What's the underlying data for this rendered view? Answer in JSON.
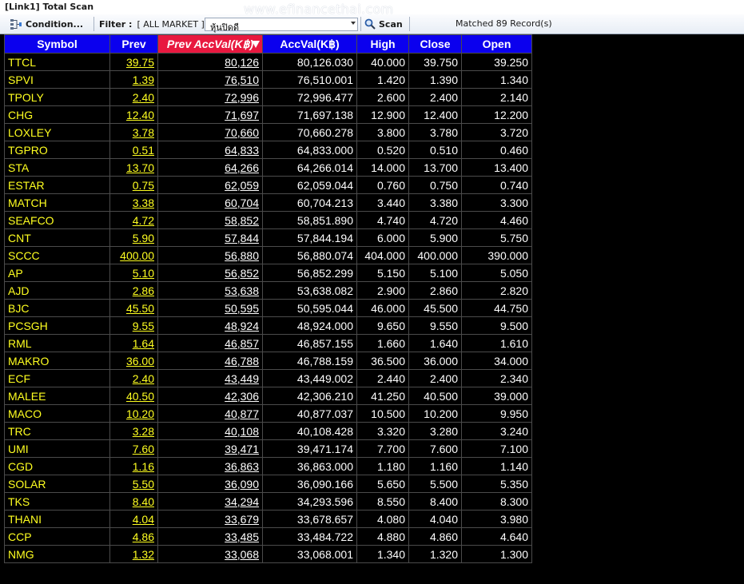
{
  "window": {
    "title": "[Link1] Total Scan"
  },
  "watermark": "www.efinancethai.com",
  "toolbar": {
    "condition_label": "Condition...",
    "filter_label": "Filter :",
    "filter_value": "[ ALL MARKET ]",
    "combo_value": "หุ้นปิดดี",
    "scan_label": "Scan",
    "matched_text": "Matched 89 Record(s)"
  },
  "table": {
    "headers": [
      "Symbol",
      "Prev",
      "Prev AccVal(K฿)",
      "AccVal(K฿)",
      "High",
      "Close",
      "Open"
    ],
    "rows": [
      [
        "TTCL",
        "39.75",
        "80,126",
        "80,126.030",
        "40.000",
        "39.750",
        "39.250"
      ],
      [
        "SPVI",
        "1.39",
        "76,510",
        "76,510.001",
        "1.420",
        "1.390",
        "1.340"
      ],
      [
        "TPOLY",
        "2.40",
        "72,996",
        "72,996.477",
        "2.600",
        "2.400",
        "2.140"
      ],
      [
        "CHG",
        "12.40",
        "71,697",
        "71,697.138",
        "12.900",
        "12.400",
        "12.200"
      ],
      [
        "LOXLEY",
        "3.78",
        "70,660",
        "70,660.278",
        "3.800",
        "3.780",
        "3.720"
      ],
      [
        "TGPRO",
        "0.51",
        "64,833",
        "64,833.000",
        "0.520",
        "0.510",
        "0.460"
      ],
      [
        "STA",
        "13.70",
        "64,266",
        "64,266.014",
        "14.000",
        "13.700",
        "13.400"
      ],
      [
        "ESTAR",
        "0.75",
        "62,059",
        "62,059.044",
        "0.760",
        "0.750",
        "0.740"
      ],
      [
        "MATCH",
        "3.38",
        "60,704",
        "60,704.213",
        "3.440",
        "3.380",
        "3.300"
      ],
      [
        "SEAFCO",
        "4.72",
        "58,852",
        "58,851.890",
        "4.740",
        "4.720",
        "4.460"
      ],
      [
        "CNT",
        "5.90",
        "57,844",
        "57,844.194",
        "6.000",
        "5.900",
        "5.750"
      ],
      [
        "SCCC",
        "400.00",
        "56,880",
        "56,880.074",
        "404.000",
        "400.000",
        "390.000"
      ],
      [
        "AP",
        "5.10",
        "56,852",
        "56,852.299",
        "5.150",
        "5.100",
        "5.050"
      ],
      [
        "AJD",
        "2.86",
        "53,638",
        "53,638.082",
        "2.900",
        "2.860",
        "2.820"
      ],
      [
        "BJC",
        "45.50",
        "50,595",
        "50,595.044",
        "46.000",
        "45.500",
        "44.750"
      ],
      [
        "PCSGH",
        "9.55",
        "48,924",
        "48,924.000",
        "9.650",
        "9.550",
        "9.500"
      ],
      [
        "RML",
        "1.64",
        "46,857",
        "46,857.155",
        "1.660",
        "1.640",
        "1.610"
      ],
      [
        "MAKRO",
        "36.00",
        "46,788",
        "46,788.159",
        "36.500",
        "36.000",
        "34.000"
      ],
      [
        "ECF",
        "2.40",
        "43,449",
        "43,449.002",
        "2.440",
        "2.400",
        "2.340"
      ],
      [
        "MALEE",
        "40.50",
        "42,306",
        "42,306.210",
        "41.250",
        "40.500",
        "39.000"
      ],
      [
        "MACO",
        "10.20",
        "40,877",
        "40,877.037",
        "10.500",
        "10.200",
        "9.950"
      ],
      [
        "TRC",
        "3.28",
        "40,108",
        "40,108.428",
        "3.320",
        "3.280",
        "3.240"
      ],
      [
        "UMI",
        "7.60",
        "39,471",
        "39,471.174",
        "7.700",
        "7.600",
        "7.100"
      ],
      [
        "CGD",
        "1.16",
        "36,863",
        "36,863.000",
        "1.180",
        "1.160",
        "1.140"
      ],
      [
        "SOLAR",
        "5.50",
        "36,090",
        "36,090.166",
        "5.650",
        "5.500",
        "5.350"
      ],
      [
        "TKS",
        "8.40",
        "34,294",
        "34,293.596",
        "8.550",
        "8.400",
        "8.300"
      ],
      [
        "THANI",
        "4.04",
        "33,679",
        "33,678.657",
        "4.080",
        "4.040",
        "3.980"
      ],
      [
        "CCP",
        "4.86",
        "33,485",
        "33,484.722",
        "4.880",
        "4.860",
        "4.640"
      ],
      [
        "NMG",
        "1.32",
        "33,068",
        "33,068.001",
        "1.340",
        "1.320",
        "1.300"
      ]
    ]
  },
  "colors": {
    "header_bg": "#0b00ee",
    "sorted_header_bg": "#e8183f",
    "symbol_text": "#ffff20",
    "value_text": "#ffffff",
    "grid_bg": "#000000"
  },
  "icons": {
    "condition": "condition-icon",
    "scan": "search-icon",
    "sort": "sort-descending-icon",
    "dropdown": "chevron-down-icon"
  }
}
